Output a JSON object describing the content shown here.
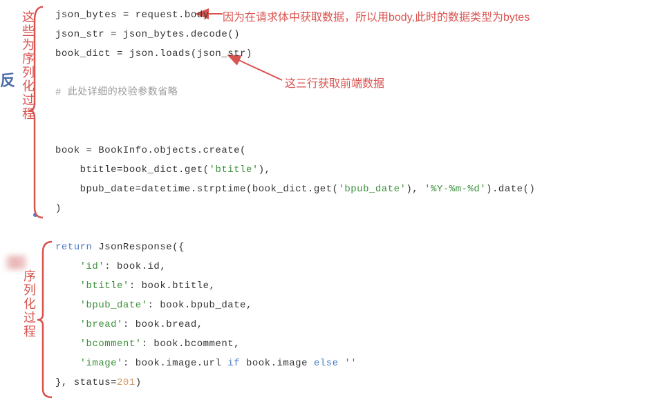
{
  "labels": {
    "vertical_top": "这些为序列化过程",
    "fan": "反",
    "vertical_bottom": "序列化过程"
  },
  "annotations": {
    "body_reason": "因为在请求体中获取数据，所以用body,此时的数据类型为bytes",
    "three_lines": "这三行获取前端数据"
  },
  "code": {
    "l1_a": "json_bytes = request.body",
    "l2_a": "json_str = json_bytes.decode()",
    "l3_a": "book_dict = json.loads(json_str)",
    "l4_cmt": "# 此处详细的校验参数省略",
    "l5_a": "book = BookInfo.objects.create(",
    "l6_a": "    btitle=book_dict.get(",
    "l6_s": "'btitle'",
    "l6_b": "),",
    "l7_a": "    bpub_date=datetime.strptime(book_dict.get(",
    "l7_s1": "'bpub_date'",
    "l7_b": "), ",
    "l7_s2": "'%Y-%m-%d'",
    "l7_c": ").date()",
    "l8_a": ")",
    "r1_a": "return",
    "r1_b": " JsonResponse({",
    "r2_s": "'id'",
    "r2_b": ": book.id,",
    "r3_s": "'btitle'",
    "r3_b": ": book.btitle,",
    "r4_s": "'bpub_date'",
    "r4_b": ": book.bpub_date,",
    "r5_s": "'bread'",
    "r5_b": ": book.bread,",
    "r6_s": "'bcomment'",
    "r6_b": ": book.bcomment,",
    "r7_s": "'image'",
    "r7_b": ": book.image.url ",
    "r7_kw1": "if",
    "r7_c": " book.image ",
    "r7_kw2": "else",
    "r7_s2": " ''",
    "r8_a": "}, status=",
    "r8_n": "201",
    "r8_b": ")"
  }
}
